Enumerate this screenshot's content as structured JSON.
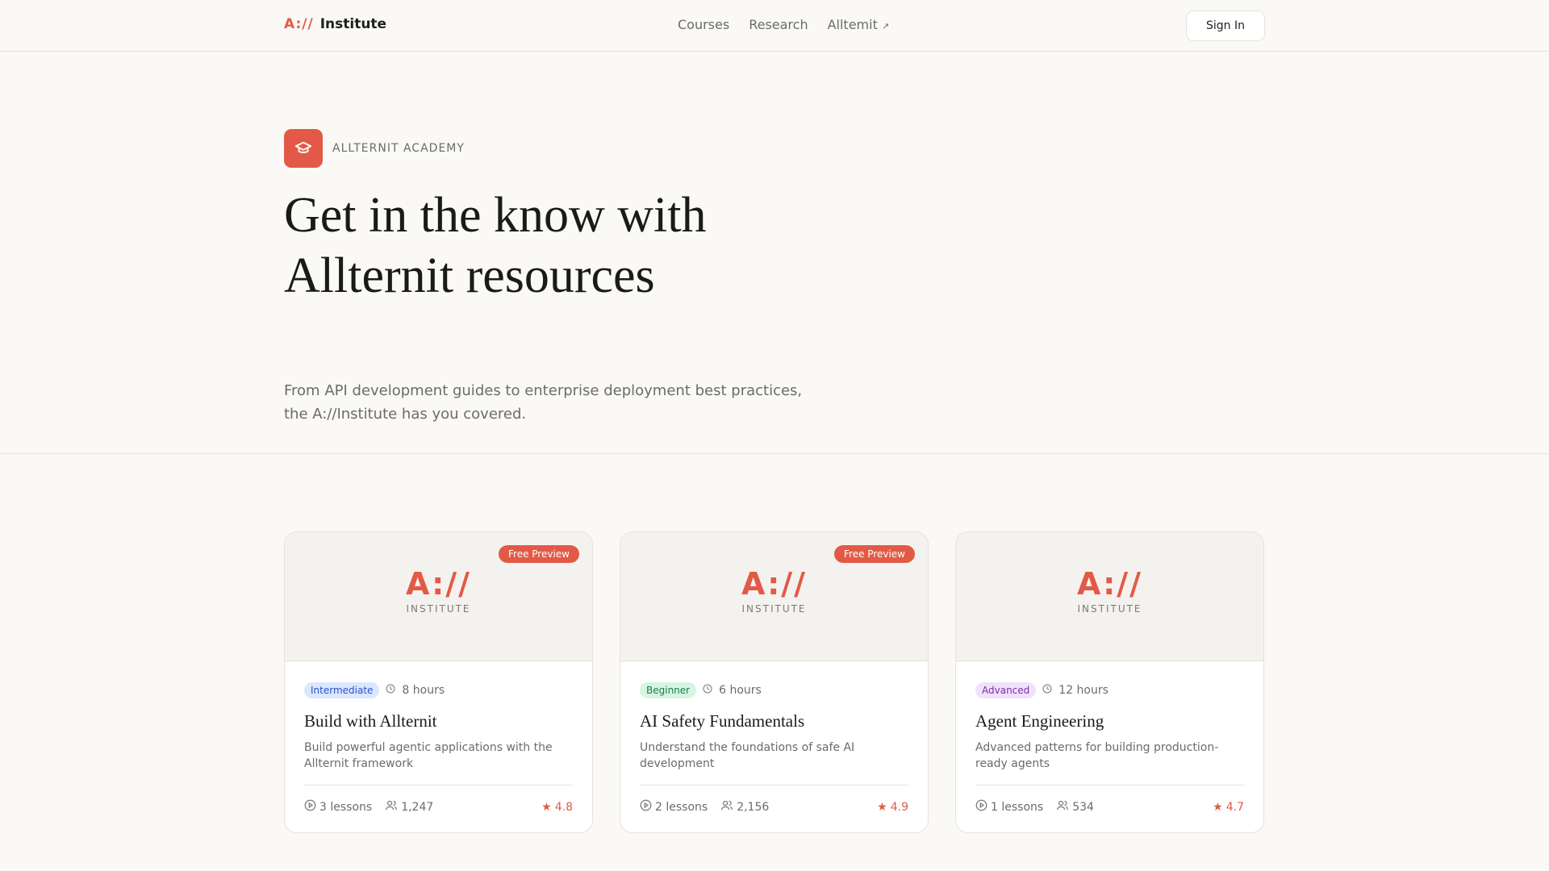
{
  "header": {
    "brand_mark": "A://",
    "brand_name": "Institute",
    "nav": [
      "Courses",
      "Research",
      "Alltemit"
    ],
    "signin": "Sign In"
  },
  "hero": {
    "eyebrow": "ALLTERNIT ACADEMY",
    "title": "Get in the know with Allternit resources",
    "subtitle": "From API development guides to enterprise deployment best practices, the A://Institute has you covered."
  },
  "cards": [
    {
      "badge": "Free Preview",
      "logo": "A://",
      "logo_sub": "INSTITUTE",
      "level": "Intermediate",
      "level_bg": "#dbe7ff",
      "level_color": "#2f4fc4",
      "duration": "8 hours",
      "title": "Build with Allternit",
      "desc": "Build powerful agentic applications with the Allternit framework",
      "lessons": "3 lessons",
      "students": "1,247",
      "rating": "4.8"
    },
    {
      "badge": "Free Preview",
      "logo": "A://",
      "logo_sub": "INSTITUTE",
      "level": "Beginner",
      "level_bg": "#d6f5e3",
      "level_color": "#1f7a4a",
      "duration": "6 hours",
      "title": "AI Safety Fundamentals",
      "desc": "Understand the foundations of safe AI development",
      "lessons": "2 lessons",
      "students": "2,156",
      "rating": "4.9"
    },
    {
      "badge": null,
      "logo": "A://",
      "logo_sub": "INSTITUTE",
      "level": "Advanced",
      "level_bg": "#f1e1fb",
      "level_color": "#7a2fa3",
      "duration": "12 hours",
      "title": "Agent Engineering",
      "desc": "Advanced patterns for building production-ready agents",
      "lessons": "1 lessons",
      "students": "534",
      "rating": "4.7"
    }
  ]
}
